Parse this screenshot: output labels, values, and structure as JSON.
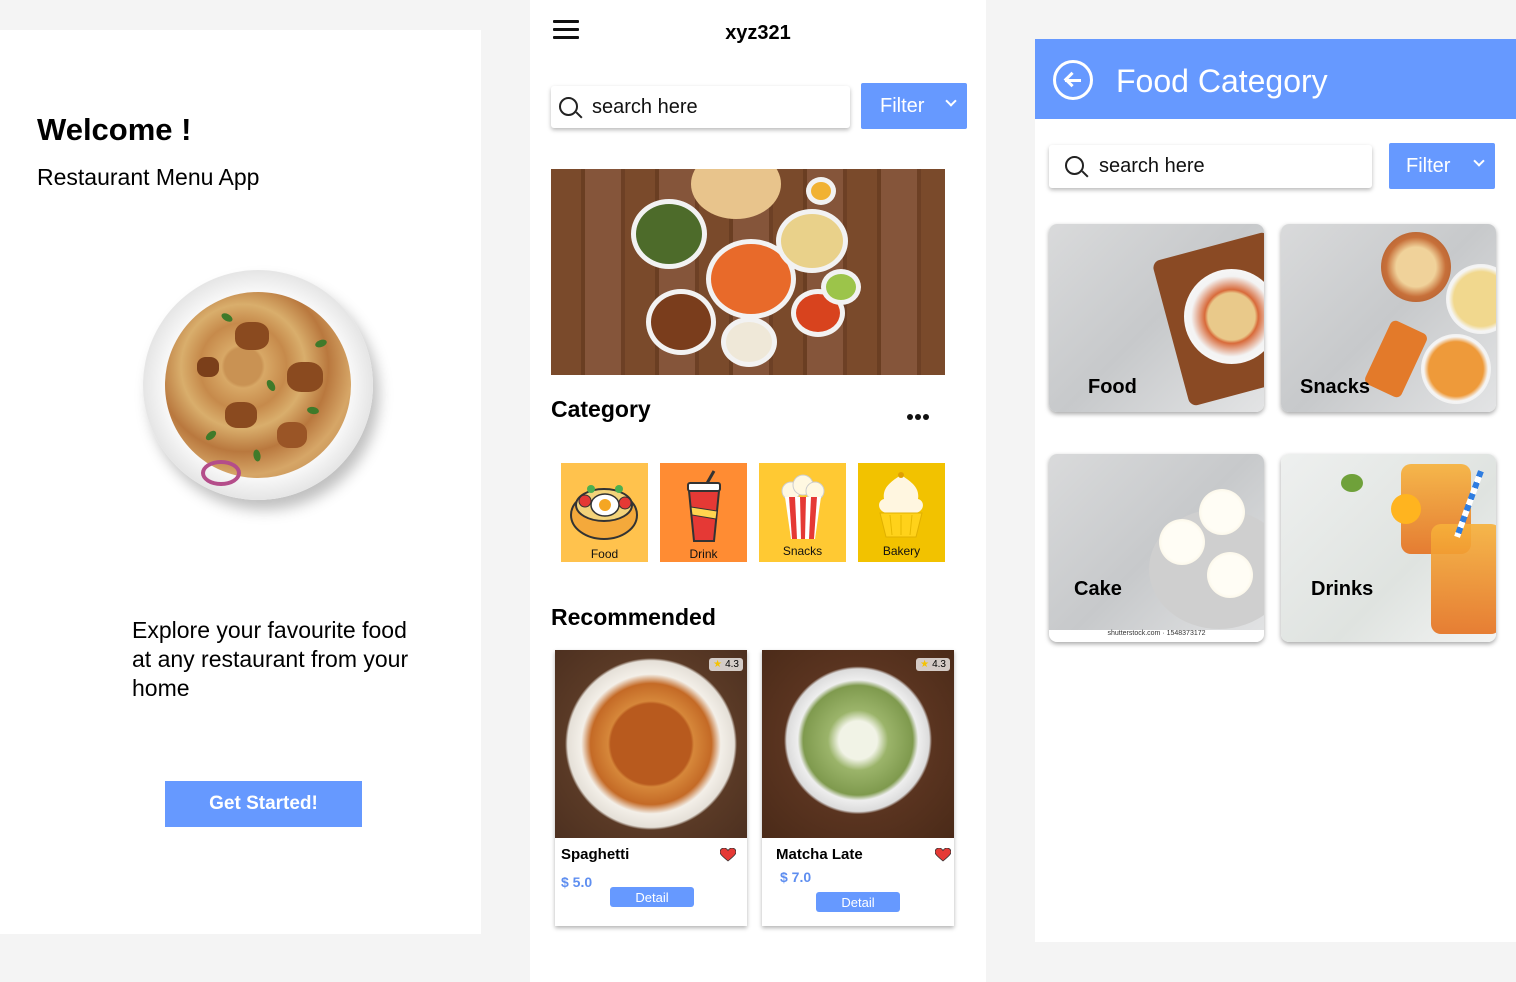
{
  "welcome": {
    "title": "Welcome !",
    "subtitle": "Restaurant Menu App",
    "explore_text": "Explore your favourite food at any restaurant from your home",
    "cta_label": "Get Started!"
  },
  "home": {
    "username": "xyz321",
    "search": {
      "placeholder": "search here"
    },
    "filter_label": "Filter",
    "category_title": "Category",
    "categories": [
      {
        "label": "Food",
        "color": "#ffc24d"
      },
      {
        "label": "Drink",
        "color": "#ff8c33"
      },
      {
        "label": "Snacks",
        "color": "#ffc933"
      },
      {
        "label": "Bakery",
        "color": "#f2c200"
      }
    ],
    "recommended_title": "Recommended",
    "recommended": [
      {
        "name": "Spaghetti",
        "price": "$ 5.0",
        "rating": "4.3",
        "detail_label": "Detail"
      },
      {
        "name": "Matcha Late",
        "price": "$ 7.0",
        "rating": "4.3",
        "detail_label": "Detail"
      }
    ]
  },
  "food_category": {
    "title": "Food Category",
    "search": {
      "placeholder": "search here"
    },
    "filter_label": "Filter",
    "tiles": [
      {
        "label": "Food"
      },
      {
        "label": "Snacks"
      },
      {
        "label": "Cake",
        "watermark": "shutterstock.com · 1548373172"
      },
      {
        "label": "Drinks"
      }
    ]
  },
  "colors": {
    "accent": "#6699ff",
    "price": "#5e8ef0",
    "heart": "#e53935"
  }
}
